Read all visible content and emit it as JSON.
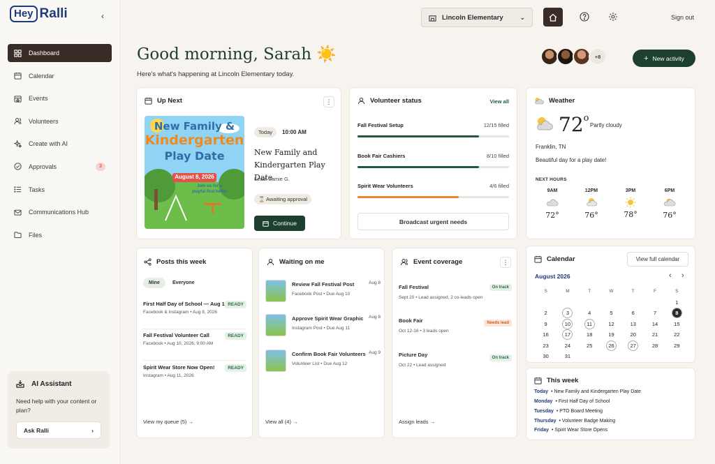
{
  "brand": {
    "hey": "Hey",
    "ralli": "Ralli"
  },
  "sidebar": {
    "items": [
      {
        "label": "Dashboard",
        "icon": "grid-icon"
      },
      {
        "label": "Calendar",
        "icon": "calendar-icon"
      },
      {
        "label": "Events",
        "icon": "calendar-star-icon"
      },
      {
        "label": "Volunteers",
        "icon": "users-icon"
      },
      {
        "label": "Create with AI",
        "icon": "sparkle-icon"
      },
      {
        "label": "Approvals",
        "icon": "check-circle-icon",
        "badge": "3"
      },
      {
        "label": "Tasks",
        "icon": "list-icon"
      },
      {
        "label": "Communications Hub",
        "icon": "mail-icon"
      },
      {
        "label": "Files",
        "icon": "folder-icon"
      }
    ],
    "ai": {
      "title": "AI Assistant",
      "desc": "Need help with your content or plan?",
      "button": "Ask Ralli"
    }
  },
  "topbar": {
    "school": "Lincoln Elementary",
    "signout": "Sign out"
  },
  "header": {
    "greeting": "Good morning, Sarah ☀️",
    "sub": "Here's what's happening at Lincoln Elementary today.",
    "more_avatars": "+8",
    "new_activity": "New activity"
  },
  "upnext": {
    "title": "Up Next",
    "poster": {
      "line1": "New Family &",
      "line2": "Kindergarten",
      "line3": "Play Date",
      "date": "August 8, 2026",
      "tag1": "Join us for a",
      "tag2": "playful first hello!"
    },
    "when_pill": "Today",
    "time": "10:00 AM",
    "event_name": "New Family and Kindergarten Play Date",
    "lead": "Lead: Jamie G.",
    "status": "Awaiting approval",
    "continue": "Continue"
  },
  "volunteer": {
    "title": "Volunteer status",
    "view_all": "View all",
    "rows": [
      {
        "name": "Fall Festival Setup",
        "filled": "12/15 filled",
        "pct": 0.8
      },
      {
        "name": "Book Fair Cashiers",
        "filled": "8/10 filled",
        "pct": 0.8
      },
      {
        "name": "Spirit Wear Volunteers",
        "filled": "4/6 filled",
        "pct": 0.67
      }
    ],
    "broadcast": "Broadcast urgent needs"
  },
  "weather": {
    "title": "Weather",
    "temp": "72",
    "deg": "o",
    "cond": "Partly cloudy",
    "location": "Franklin, TN",
    "note": "Beautiful day for a play date!",
    "next_label": "NEXT HOURS",
    "hours": [
      {
        "t": "9AM",
        "temp": "72°",
        "icon": "cloud-icon"
      },
      {
        "t": "12PM",
        "temp": "76°",
        "icon": "partly-sunny-icon"
      },
      {
        "t": "3PM",
        "temp": "78°",
        "icon": "sun-icon"
      },
      {
        "t": "6PM",
        "temp": "76°",
        "icon": "cloud-icon"
      }
    ]
  },
  "posts": {
    "title": "Posts this week",
    "tabs": [
      "Mine",
      "Everyone"
    ],
    "rows": [
      {
        "t": "First Half Day of School — Aug 14",
        "m": "Facebook & Instagram • Aug 8, 2026",
        "s": "READY"
      },
      {
        "t": "Fall Festival Volunteer Call",
        "m": "Facebook • Aug 10, 2026, 9:00 AM",
        "s": "READY"
      },
      {
        "t": "Spirit Wear Store Now Open!",
        "m": "Instagram • Aug 11, 2026",
        "s": "READY"
      }
    ],
    "footer": "View my queue (5) →"
  },
  "waiting": {
    "title": "Waiting on me",
    "rows": [
      {
        "t": "Review Fall Festival Post",
        "d": "Aug 8",
        "m": "Facebook Post • Due Aug 10"
      },
      {
        "t": "Approve Spirit Wear Graphic",
        "d": "Aug 8",
        "m": "Instagram Post • Due Aug 11"
      },
      {
        "t": "Confirm Book Fair Volunteers",
        "d": "Aug 9",
        "m": "Volunteer List • Due Aug 12"
      }
    ],
    "footer": "View all (4) →"
  },
  "coverage": {
    "title": "Event coverage",
    "rows": [
      {
        "t": "Fall Festival",
        "m": "Sept 20 • Lead assigned, 2 co-leads open",
        "s": "On track",
        "kind": "ok"
      },
      {
        "t": "Book Fair",
        "m": "Oct 12-16 • 3 leads open",
        "s": "Needs lead",
        "kind": "need"
      },
      {
        "t": "Picture Day",
        "m": "Oct 22 • Lead assigned",
        "s": "On track",
        "kind": "ok"
      }
    ],
    "footer": "Assign leads →"
  },
  "calendar": {
    "title": "Calendar",
    "view_full": "View full calendar",
    "month": "August 2026",
    "dow": [
      "S",
      "M",
      "T",
      "W",
      "T",
      "F",
      "S"
    ],
    "weeks": [
      [
        "",
        "",
        "",
        "",
        "",
        "",
        "1"
      ],
      [
        "2",
        "3",
        "4",
        "5",
        "6",
        "7",
        "8"
      ],
      [
        "9",
        "10",
        "11",
        "12",
        "13",
        "14",
        "15"
      ],
      [
        "16",
        "17",
        "18",
        "19",
        "20",
        "21",
        "22"
      ],
      [
        "23",
        "24",
        "25",
        "26",
        "27",
        "28",
        "29"
      ],
      [
        "30",
        "31",
        "",
        "",
        "",
        "",
        ""
      ]
    ],
    "ringed": [
      "3",
      "10",
      "11",
      "17",
      "26",
      "27"
    ],
    "today": "8"
  },
  "thisweek": {
    "title": "This week",
    "rows": [
      {
        "d": "Today",
        "e": "• New Family and Kindergarten Play Date"
      },
      {
        "d": "Monday",
        "e": "• First Half Day of School"
      },
      {
        "d": "Tuesday",
        "e": "• PTO Board Meeting"
      },
      {
        "d": "Thursday",
        "e": "• Volunteer Badge Making"
      },
      {
        "d": "Friday",
        "e": "• Spirit Wear Store Opens"
      }
    ]
  }
}
